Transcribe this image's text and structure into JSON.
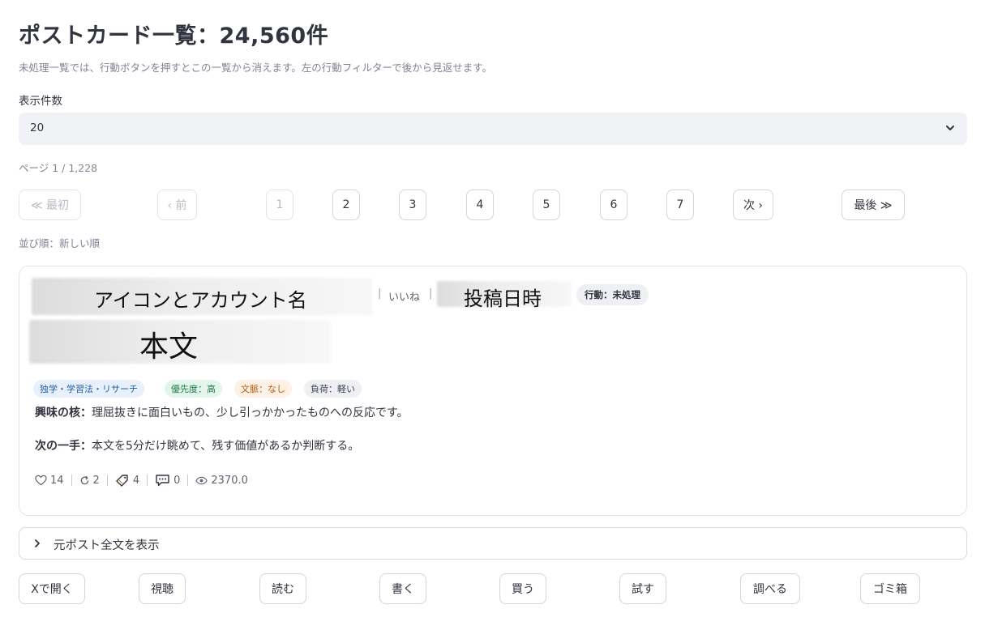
{
  "header": {
    "title": "ポストカード一覧：24,560件",
    "subtitle": "未処理一覧では、行動ボタンを押すとこの一覧から消えます。左の行動フィルターで後から見返せます。"
  },
  "page_size": {
    "label": "表示件数",
    "value": "20"
  },
  "pagination": {
    "info": "ページ 1 / 1,228",
    "first": "≪ 最初",
    "prev": "‹ 前",
    "pages": [
      "1",
      "2",
      "3",
      "4",
      "5",
      "6",
      "7"
    ],
    "current_page": "1",
    "next": "次 ›",
    "last": "最後 ≫"
  },
  "sort_label": "並び順：新しい順",
  "card": {
    "account_placeholder": "アイコンとアカウント名",
    "like_label": "いいね",
    "date_placeholder": "投稿日時",
    "action_badge": "行動：未処理",
    "body_placeholder": "本文",
    "tags": [
      {
        "text": "独学・学習法・リサーチ",
        "bg": "#e8f1fb",
        "fg": "#1f5fa8"
      },
      {
        "text": "優先度：高",
        "bg": "#e3f5ec",
        "fg": "#1d7a4a"
      },
      {
        "text": "文脈：なし",
        "bg": "#fdf0e4",
        "fg": "#b25a12"
      },
      {
        "text": "負荷：軽い",
        "bg": "#eef0f4",
        "fg": "#3f4352"
      }
    ],
    "interest_label": "興味の核：",
    "interest_text": "理屈抜きに面白いもの、少し引っかかったものへの反応です。",
    "next_label": "次の一手：",
    "next_text": "本文を5分だけ眺めて、残す価値があるか判断する。",
    "stats": {
      "likes": "14",
      "reposts": "2",
      "bookmarks": "4",
      "replies": "0",
      "views": "2370.0"
    },
    "icons": [
      "heart-icon",
      "repost-icon",
      "bookmark-icon",
      "reply-icon",
      "eye-icon"
    ]
  },
  "expander": {
    "label": "元ポスト全文を表示"
  },
  "actions": [
    "Xで開く",
    "視聴",
    "読む",
    "書く",
    "買う",
    "試す",
    "調べる",
    "ゴミ箱"
  ],
  "colors": {
    "text": "#31333f",
    "muted": "#808495",
    "select_bg": "#f0f2f6",
    "border": "#d3d5db"
  }
}
